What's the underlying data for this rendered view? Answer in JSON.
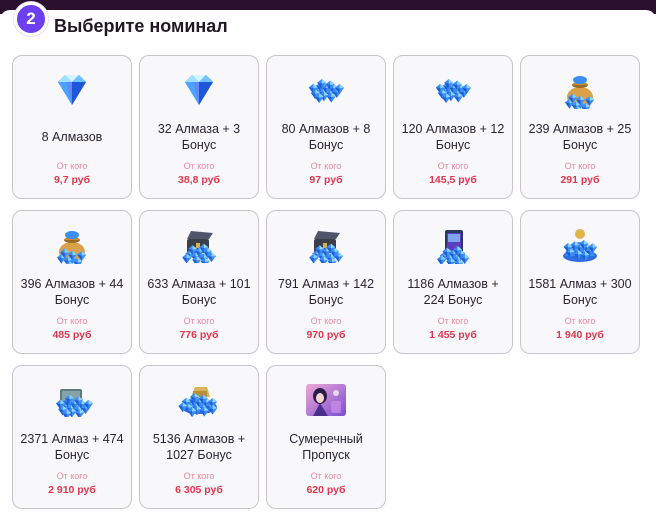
{
  "header": {
    "step": "2",
    "title": "Выберите номинал"
  },
  "colors": {
    "accent": "#6c3ff0",
    "topbar": "#2a0f2e",
    "price": "#e0374f",
    "from_label": "#e98aa0",
    "card_bg": "#f8f7f9",
    "card_border": "#c9c4cc"
  },
  "items": [
    {
      "name": "8 Алмазов",
      "from": "От кого",
      "price": "9,7 руб",
      "icon": "diamond-icon"
    },
    {
      "name": "32 Алмаза + 3 Бонус",
      "from": "От кого",
      "price": "38,8 руб",
      "icon": "diamond-icon"
    },
    {
      "name": "80 Алмазов + 8 Бонус",
      "from": "От кого",
      "price": "97 руб",
      "icon": "diamond-pile-icon"
    },
    {
      "name": "120 Алмазов + 12 Бонус",
      "from": "От кого",
      "price": "145,5 руб",
      "icon": "diamond-pile-icon"
    },
    {
      "name": "239 Алмазов + 25 Бонус",
      "from": "От кого",
      "price": "291 руб",
      "icon": "diamond-bag-icon"
    },
    {
      "name": "396 Алмазов + 44 Бонус",
      "from": "От кого",
      "price": "485 руб",
      "icon": "diamond-bag-icon"
    },
    {
      "name": "633 Алмаза + 101 Бонус",
      "from": "От кого",
      "price": "776 руб",
      "icon": "diamond-chest-icon"
    },
    {
      "name": "791 Алмаз + 142 Бонус",
      "from": "От кого",
      "price": "970 руб",
      "icon": "diamond-chest-icon"
    },
    {
      "name": "1186 Алмазов + 224 Бонус",
      "from": "От кого",
      "price": "1 455 руб",
      "icon": "diamond-crate-icon"
    },
    {
      "name": "1581 Алмаз + 300 Бонус",
      "from": "От кого",
      "price": "1 940 руб",
      "icon": "diamond-mound-icon"
    },
    {
      "name": "2371 Алмаз + 474 Бонус",
      "from": "От кого",
      "price": "2 910 руб",
      "icon": "diamond-cart-icon"
    },
    {
      "name": "5136 Алмазов + 1027 Бонус",
      "from": "От кого",
      "price": "6 305 руб",
      "icon": "diamond-hoard-icon"
    },
    {
      "name": "Сумеречный Пропуск",
      "from": "От кого",
      "price": "620 руб",
      "icon": "twilight-pass-icon"
    }
  ]
}
